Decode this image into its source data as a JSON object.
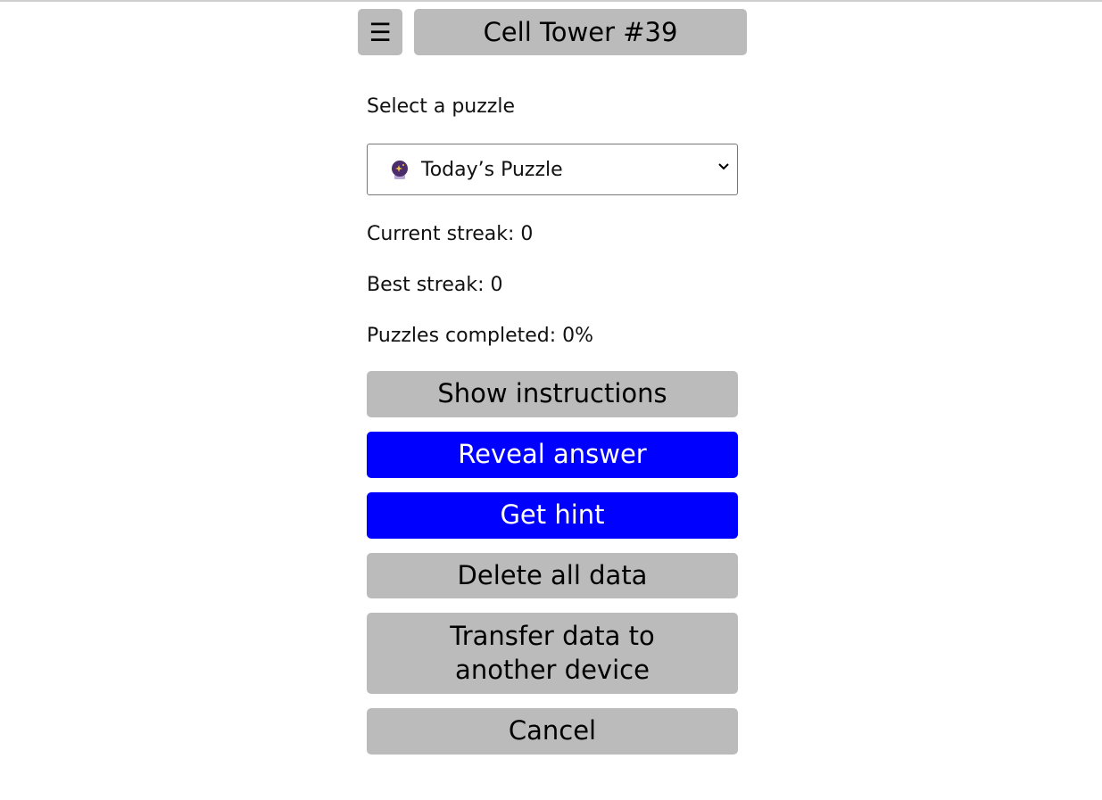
{
  "header": {
    "menu_icon": "hamburger-icon",
    "menu_glyph": "☰",
    "title": "Cell Tower #39"
  },
  "puzzle_select": {
    "label": "Select a puzzle",
    "selected_icon": "crystal-ball-icon",
    "selected_value": "Today’s Puzzle"
  },
  "stats": {
    "current_streak": "Current streak: 0",
    "best_streak": "Best streak: 0",
    "puzzles_completed": "Puzzles completed: 0%"
  },
  "buttons": {
    "show_instructions": "Show instructions",
    "reveal_answer": "Reveal answer",
    "get_hint": "Get hint",
    "delete_all_data": "Delete all data",
    "transfer_data": "Transfer data to another device",
    "cancel": "Cancel"
  },
  "colors": {
    "gray_button": "#bbbbbb",
    "primary_button": "#0000ff"
  }
}
